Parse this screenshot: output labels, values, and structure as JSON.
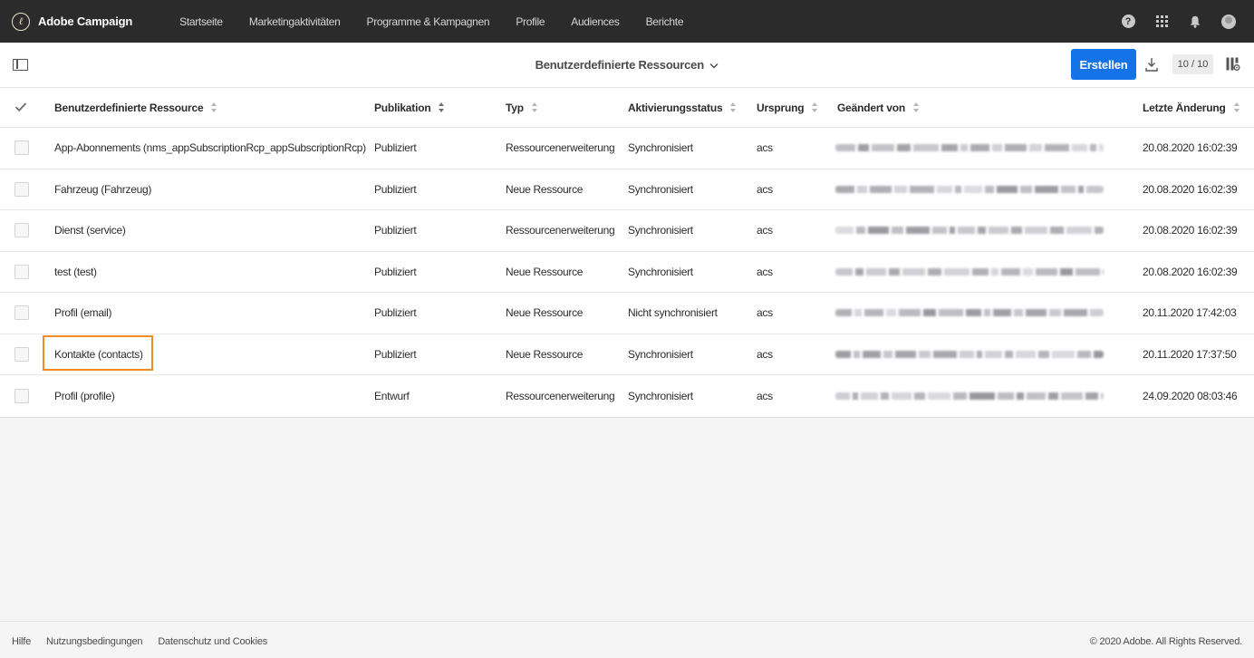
{
  "app": {
    "brand": "Adobe Campaign",
    "nav": [
      "Startseite",
      "Marketingaktivitäten",
      "Programme & Kampagnen",
      "Profile",
      "Audiences",
      "Berichte"
    ],
    "icons": [
      "help-icon",
      "apps-grid-icon",
      "bell-icon",
      "user-avatar-icon"
    ]
  },
  "toolbar": {
    "title": "Benutzerdefinierte Ressourcen",
    "create_label": "Erstellen",
    "count": "10 / 10",
    "accent": "#1473e6"
  },
  "table": {
    "headers": [
      "Benutzerdefinierte Ressource",
      "Publikation",
      "Typ",
      "Aktivierungsstatus",
      "Ursprung",
      "Geändert von",
      "Letzte Änderung"
    ],
    "rows": [
      {
        "name": "App-Abonnements (nms_appSubscriptionRcp_appSubscriptionRcp)",
        "publication": "Publiziert",
        "type": "Ressourcenerweiterung",
        "status": "Synchronisiert",
        "origin": "acs",
        "modified": "20.08.2020 16:02:39"
      },
      {
        "name": "Fahrzeug (Fahrzeug)",
        "publication": "Publiziert",
        "type": "Neue Ressource",
        "status": "Synchronisiert",
        "origin": "acs",
        "modified": "20.08.2020 16:02:39"
      },
      {
        "name": "Dienst (service)",
        "publication": "Publiziert",
        "type": "Ressourcenerweiterung",
        "status": "Synchronisiert",
        "origin": "acs",
        "modified": "20.08.2020 16:02:39"
      },
      {
        "name": "test (test)",
        "publication": "Publiziert",
        "type": "Neue Ressource",
        "status": "Synchronisiert",
        "origin": "acs",
        "modified": "20.08.2020 16:02:39"
      },
      {
        "name": "Profil (email)",
        "publication": "Publiziert",
        "type": "Neue Ressource",
        "status": "Nicht synchronisiert",
        "origin": "acs",
        "modified": "20.11.2020 17:42:03"
      },
      {
        "name": "Kontakte (contacts)",
        "publication": "Publiziert",
        "type": "Neue Ressource",
        "status": "Synchronisiert",
        "origin": "acs",
        "modified": "20.11.2020 17:37:50"
      },
      {
        "name": "Profil (profile)",
        "publication": "Entwurf",
        "type": "Ressourcenerweiterung",
        "status": "Synchronisiert",
        "origin": "acs",
        "modified": "24.09.2020 08:03:46"
      }
    ],
    "highlight_color": "#f08a24"
  },
  "footer": {
    "links": [
      "Hilfe",
      "Nutzungsbedingungen",
      "Datenschutz und Cookies"
    ],
    "copyright": "© 2020 Adobe. All Rights Reserved."
  }
}
